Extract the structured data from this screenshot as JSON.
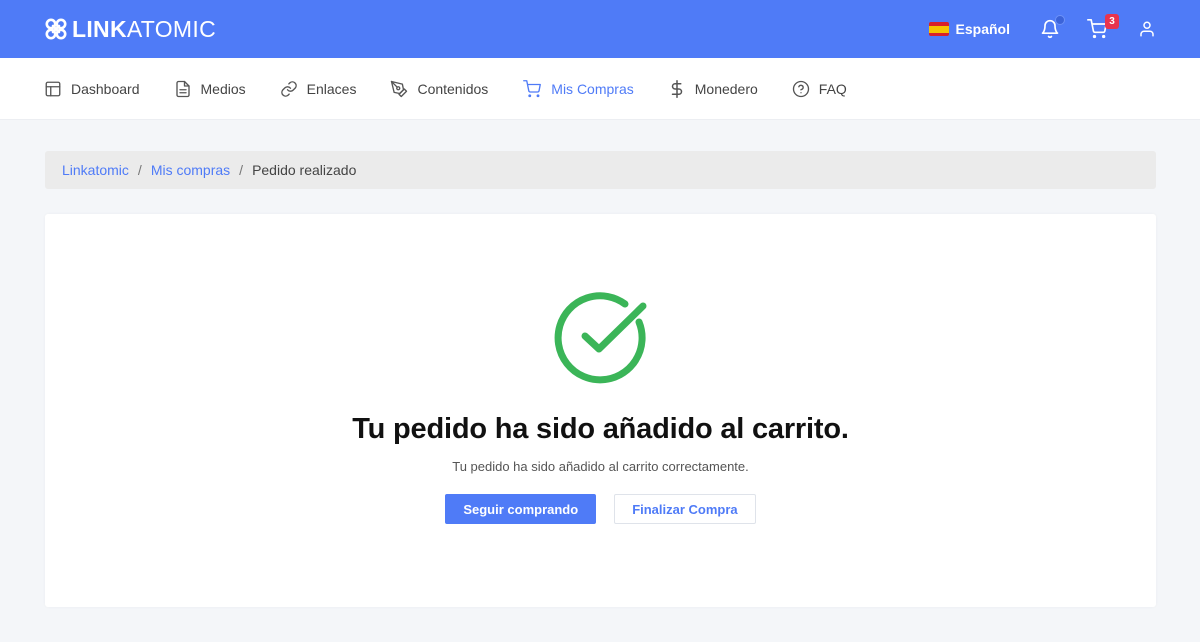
{
  "header": {
    "logo_bold": "LINK",
    "logo_light": "ATOMIC",
    "language": "Español",
    "cart_count": "3",
    "icons": [
      "logo-icon",
      "spain-flag-icon",
      "bell-icon",
      "cart-icon",
      "user-icon"
    ]
  },
  "nav": {
    "items": [
      {
        "label": "Dashboard",
        "icon": "layout-icon",
        "active": false
      },
      {
        "label": "Medios",
        "icon": "document-icon",
        "active": false
      },
      {
        "label": "Enlaces",
        "icon": "link-icon",
        "active": false
      },
      {
        "label": "Contenidos",
        "icon": "pen-icon",
        "active": false
      },
      {
        "label": "Mis Compras",
        "icon": "cart-icon",
        "active": true
      },
      {
        "label": "Monedero",
        "icon": "dollar-icon",
        "active": false
      },
      {
        "label": "FAQ",
        "icon": "help-circle-icon",
        "active": false
      }
    ]
  },
  "breadcrumb": {
    "root": "Linkatomic",
    "parent": "Mis compras",
    "current": "Pedido realizado",
    "separator": "/"
  },
  "main": {
    "title": "Tu pedido ha sido añadido al carrito.",
    "subtitle": "Tu pedido ha sido añadido al carrito correctamente.",
    "primary_button": "Seguir comprando",
    "secondary_button": "Finalizar Compra"
  },
  "colors": {
    "primary": "#4f7bf7",
    "success": "#3bb558",
    "badge": "#e8344e"
  }
}
